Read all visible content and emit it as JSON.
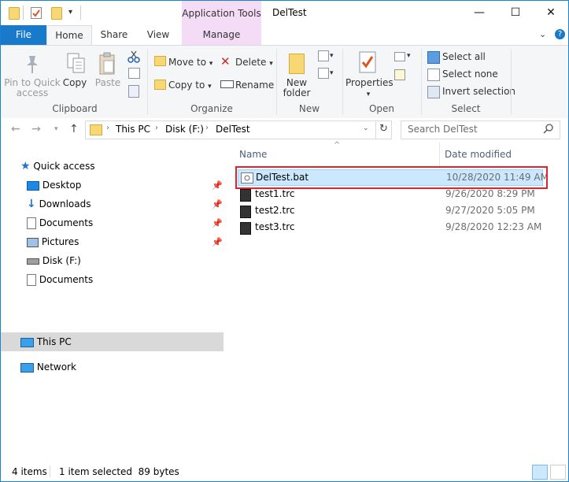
{
  "window": {
    "title": "DelTest",
    "minimize": "—",
    "maximize": "☐",
    "close": "✕"
  },
  "ribbon_tabs": {
    "file": "File",
    "home": "Home",
    "share": "Share",
    "view": "View",
    "manage": "Manage",
    "contextual_group": "Application Tools"
  },
  "ribbon": {
    "clipboard": {
      "group_label": "Clipboard",
      "pin_label": "Pin to Quick access",
      "copy_label": "Copy",
      "paste_label": "Paste"
    },
    "organize": {
      "group_label": "Organize",
      "move_to": "Move to",
      "copy_to": "Copy to",
      "delete": "Delete",
      "rename": "Rename"
    },
    "new": {
      "group_label": "New",
      "new_folder": "New folder"
    },
    "open": {
      "group_label": "Open",
      "properties": "Properties"
    },
    "select": {
      "group_label": "Select",
      "select_all": "Select all",
      "select_none": "Select none",
      "invert_selection": "Invert selection"
    }
  },
  "address": {
    "crumbs": [
      "This PC",
      "Disk (F:)",
      "DelTest"
    ],
    "search_placeholder": "Search DelTest"
  },
  "nav_pane": {
    "quick_access": "Quick access",
    "items": [
      {
        "label": "Desktop",
        "icon": "desktop-icon",
        "pinned": true
      },
      {
        "label": "Downloads",
        "icon": "downloads-icon",
        "pinned": true
      },
      {
        "label": "Documents",
        "icon": "documents-icon",
        "pinned": true
      },
      {
        "label": "Pictures",
        "icon": "pictures-icon",
        "pinned": true
      },
      {
        "label": "Disk (F:)",
        "icon": "drive-icon",
        "pinned": false
      },
      {
        "label": "Documents",
        "icon": "documents-icon",
        "pinned": false
      }
    ],
    "this_pc": "This PC",
    "network": "Network"
  },
  "file_list": {
    "columns": {
      "name": "Name",
      "date_modified": "Date modified"
    },
    "rows": [
      {
        "name": "DelTest.bat",
        "date": "10/28/2020 11:49 AM",
        "icon": "batch-file-icon",
        "selected": true
      },
      {
        "name": "test1.trc",
        "date": "9/26/2020 8:29 PM",
        "icon": "trc-file-icon",
        "selected": false
      },
      {
        "name": "test2.trc",
        "date": "9/27/2020 5:05 PM",
        "icon": "trc-file-icon",
        "selected": false
      },
      {
        "name": "test3.trc",
        "date": "9/28/2020 12:23 AM",
        "icon": "trc-file-icon",
        "selected": false
      }
    ]
  },
  "status_bar": {
    "item_count": "4 items",
    "selection": "1 item selected  89 bytes"
  },
  "colors": {
    "accent": "#1979ca",
    "selection_bg": "#cce8ff",
    "highlight_border": "#e0242b",
    "contextual_tab": "#f4dcf7"
  }
}
